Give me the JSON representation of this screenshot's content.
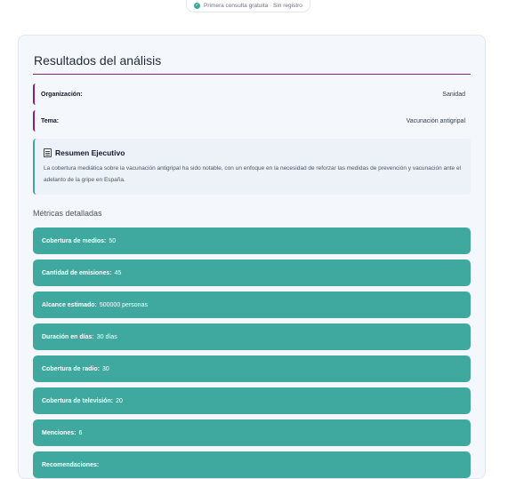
{
  "badge": {
    "icon": "check-circle-icon",
    "text": "Primera consulta gratuita · Sin registro"
  },
  "results": {
    "title": "Resultados del análisis",
    "info": [
      {
        "label": "Organización:",
        "value": "Sanidad"
      },
      {
        "label": "Tema:",
        "value": "Vacunación antigripal"
      }
    ],
    "summary": {
      "icon": "clipboard-icon",
      "title": "Resumen Ejecutivo",
      "text": "La cobertura mediática sobre la vacunación antigripal ha sido notable, con un enfoque en la necesidad de reforzar las medidas de prevención y vacunación ante el adelanto de la gripe en España."
    },
    "metrics_title": "Métricas detalladas",
    "metrics": [
      {
        "label": "Cobertura de medios:",
        "value": "50"
      },
      {
        "label": "Cantidad de emisiones:",
        "value": "45"
      },
      {
        "label": "Alcance estimado:",
        "value": "500000 personas"
      },
      {
        "label": "Duración en días:",
        "value": "30 días"
      },
      {
        "label": "Cobertura de radio:",
        "value": "30"
      },
      {
        "label": "Cobertura de televisión:",
        "value": "20"
      },
      {
        "label": "Menciones:",
        "value": "6"
      },
      {
        "label": "Recomendaciones:",
        "value": ""
      }
    ]
  },
  "colors": {
    "accent_purple": "#8a1f7a",
    "accent_teal": "#3fa9a0"
  }
}
